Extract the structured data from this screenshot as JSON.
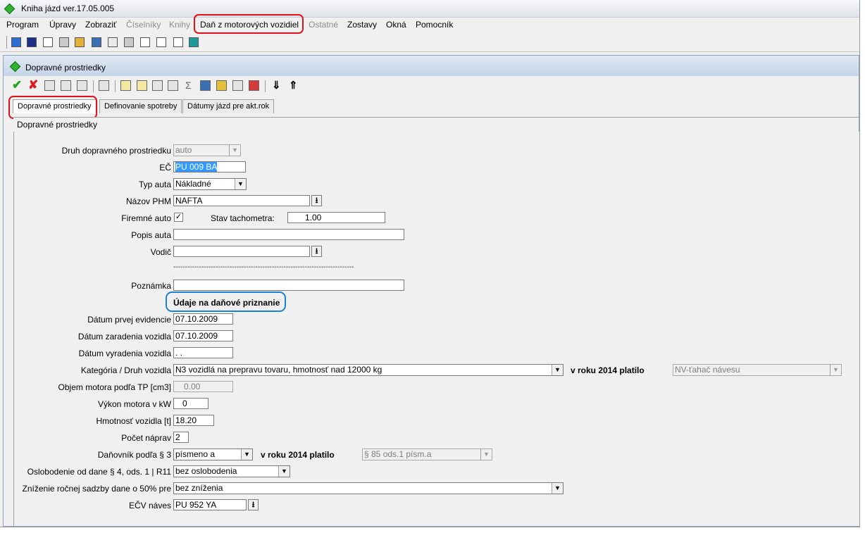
{
  "app": {
    "title": "Kniha jázd ver.17.05.005"
  },
  "menu": [
    {
      "label": "Program",
      "enabled": true
    },
    {
      "label": "Úpravy",
      "enabled": true
    },
    {
      "label": "Zobraziť",
      "enabled": true
    },
    {
      "label": "Číselníky",
      "enabled": false
    },
    {
      "label": "Knihy",
      "enabled": false
    },
    {
      "label": "Daň z motorových vozidiel",
      "enabled": true
    },
    {
      "label": "Ostatné",
      "enabled": false
    },
    {
      "label": "Zostavy",
      "enabled": true
    },
    {
      "label": "Okná",
      "enabled": true
    },
    {
      "label": "Pomocník",
      "enabled": true
    }
  ],
  "window": {
    "title": "Dopravné prostriedky"
  },
  "tabs": [
    {
      "label": "Dopravné prostriedky",
      "active": true
    },
    {
      "label": "Definovanie spotreby",
      "active": false
    },
    {
      "label": "Dátumy jázd pre akt.rok",
      "active": false
    }
  ],
  "panel": {
    "title": "Dopravné prostriedky"
  },
  "form": {
    "druh": {
      "label": "Druh dopravného prostriedku",
      "value": "auto"
    },
    "ec": {
      "label": "EČ",
      "value": "PU 009 BA"
    },
    "typ": {
      "label": "Typ auta",
      "value": "Nákladné"
    },
    "phm": {
      "label": "Názov PHM",
      "value": "NAFTA"
    },
    "firemne": {
      "label": "Firemné auto",
      "checked": "✓"
    },
    "tacho": {
      "label": "Stav tachometra:",
      "value": "1.00"
    },
    "popis": {
      "label": "Popis auta",
      "value": ""
    },
    "vodic": {
      "label": "Vodič",
      "value": ""
    },
    "divider": "-----------------------------------------------------------------------------",
    "poznamka": {
      "label": "Poznámka",
      "value": ""
    },
    "section": "Údaje na daňové priznanie",
    "datum_evid": {
      "label": "Dátum prvej evidencie",
      "value": "07.10.2009"
    },
    "datum_zar": {
      "label": "Dátum zaradenia vozidla",
      "value": "07.10.2009"
    },
    "datum_vyr": {
      "label": "Dátum vyradenia vozidla",
      "value": " . ."
    },
    "kategoria": {
      "label": "Kategória / Druh vozidla",
      "value": "N3 vozidlá na prepravu tovaru, hmotnosť nad 12000 kg"
    },
    "kat_platilo": {
      "label": "v roku 2014 platilo",
      "value": "NV-ťahač návesu"
    },
    "objem": {
      "label": "Objem motora podľa TP [cm3]",
      "value": "0.00"
    },
    "vykon": {
      "label": "Výkon motora v kW",
      "value": "0"
    },
    "hmotnost": {
      "label": "Hmotnosť vozidla  [t]",
      "value": "18.20"
    },
    "napravy": {
      "label": "Počet náprav",
      "value": "2"
    },
    "danovnik": {
      "label": "Daňovník podľa § 3",
      "value": "písmeno a"
    },
    "dan_platilo": {
      "label": "v roku 2014 platilo",
      "value": "§ 85 ods.1 písm.a"
    },
    "oslobodenie": {
      "label": "Oslobodenie od dane § 4, ods. 1 | R11",
      "value": "bez oslobodenia"
    },
    "znizenie": {
      "label": "Zníženie ročnej sadzby dane o 50% pre",
      "value": "bez zníženia"
    },
    "ecv_naves": {
      "label": "EČV náves",
      "value": "PU 952 YA"
    }
  },
  "icons": {
    "dropdown": "▼",
    "picker": "⭳",
    "confirm": "✔",
    "cancel": "✘"
  }
}
